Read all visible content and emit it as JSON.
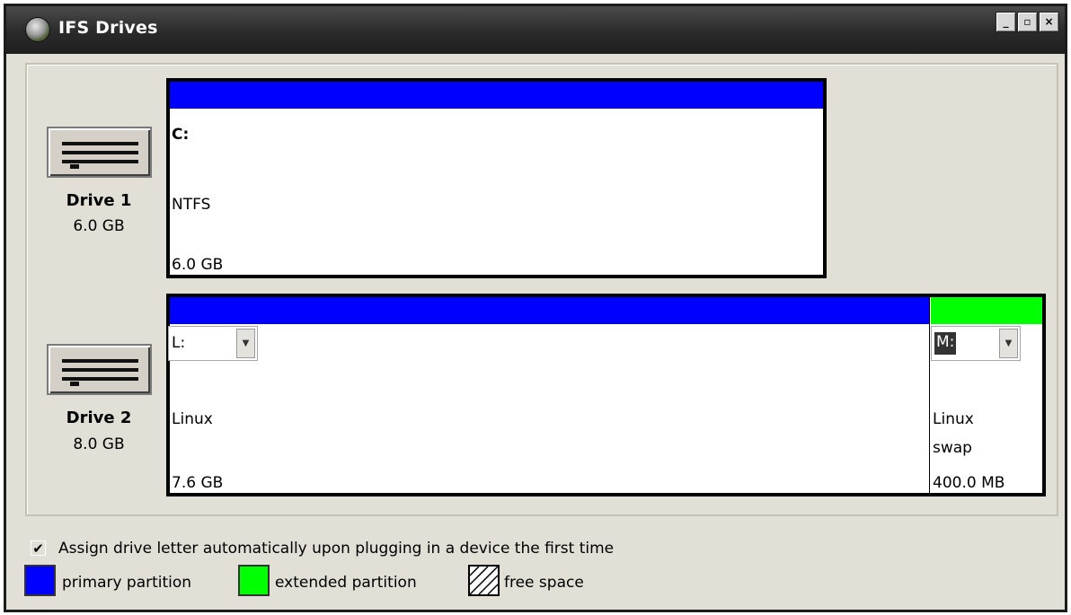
{
  "window": {
    "title": "IFS Drives",
    "min_glyph": "_",
    "max_glyph": "▫",
    "close_glyph": "×"
  },
  "colors": {
    "primary": "#0000ff",
    "extended": "#00ff00",
    "bar_inactive": "#ffffff"
  },
  "drives": [
    {
      "name": "Drive 1",
      "size": "6.0 GB",
      "partitions": [
        {
          "type": "primary",
          "letter": "C:",
          "filesystem": "NTFS",
          "size": "6.0 GB"
        }
      ]
    },
    {
      "name": "Drive 2",
      "size": "8.0 GB",
      "partitions": [
        {
          "type": "primary",
          "letter": "L:",
          "filesystem": "Linux",
          "size": "7.6 GB"
        },
        {
          "type": "extended",
          "letter": "M:",
          "filesystem_line1": "Linux",
          "filesystem_line2": "swap",
          "size": "400.0 MB"
        }
      ]
    }
  ],
  "options": {
    "auto_assign": {
      "checked": true,
      "label": "Assign drive letter automatically upon plugging in a device the first time"
    }
  },
  "legend": [
    {
      "label": "primary partition",
      "color": "#0000ff"
    },
    {
      "label": "extended partition",
      "color": "#00ff00"
    },
    {
      "label": "free space",
      "pattern": "hatched"
    }
  ]
}
